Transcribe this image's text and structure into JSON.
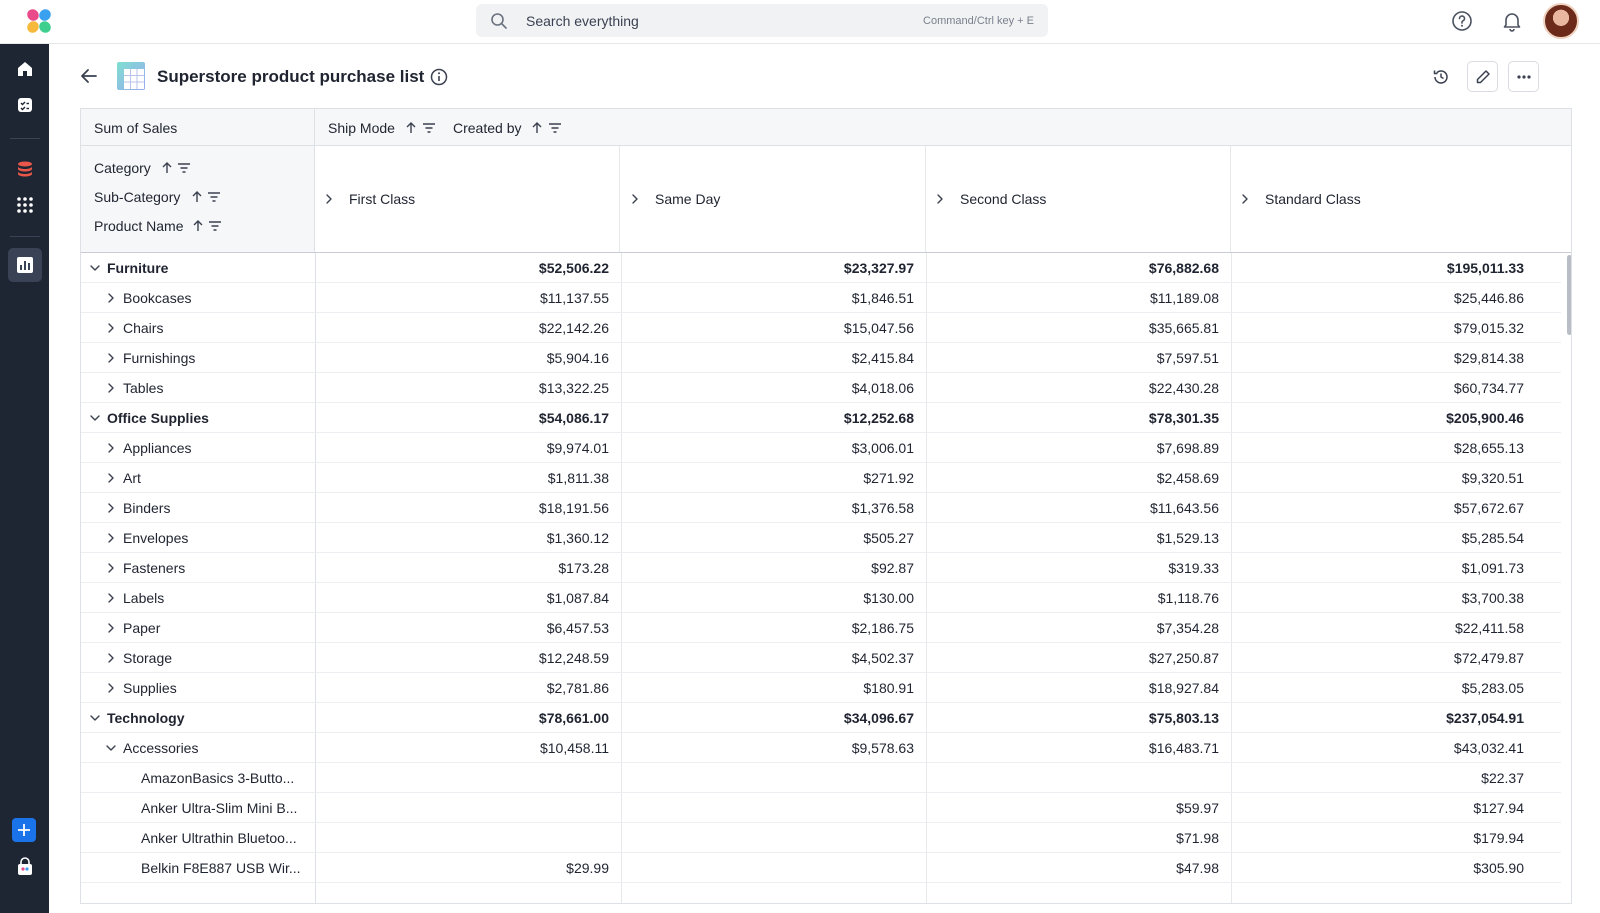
{
  "topbar": {
    "search_placeholder": "Search everything",
    "search_hint": "Command/Ctrl key + E"
  },
  "page": {
    "title": "Superstore product purchase list"
  },
  "pivot": {
    "value_label": "Sum of Sales",
    "column_fields": [
      "Ship Mode",
      "Created by"
    ],
    "row_fields": [
      "Category",
      "Sub-Category",
      "Product Name"
    ],
    "columns": [
      "First Class",
      "Same Day",
      "Second Class",
      "Standard Class"
    ],
    "rows": [
      {
        "level": 0,
        "expanded": true,
        "label": "Furniture",
        "values": [
          "$52,506.22",
          "$23,327.97",
          "$76,882.68",
          "$195,011.33"
        ]
      },
      {
        "level": 1,
        "expanded": false,
        "label": "Bookcases",
        "values": [
          "$11,137.55",
          "$1,846.51",
          "$11,189.08",
          "$25,446.86"
        ]
      },
      {
        "level": 1,
        "expanded": false,
        "label": "Chairs",
        "values": [
          "$22,142.26",
          "$15,047.56",
          "$35,665.81",
          "$79,015.32"
        ]
      },
      {
        "level": 1,
        "expanded": false,
        "label": "Furnishings",
        "values": [
          "$5,904.16",
          "$2,415.84",
          "$7,597.51",
          "$29,814.38"
        ]
      },
      {
        "level": 1,
        "expanded": false,
        "label": "Tables",
        "values": [
          "$13,322.25",
          "$4,018.06",
          "$22,430.28",
          "$60,734.77"
        ]
      },
      {
        "level": 0,
        "expanded": true,
        "label": "Office Supplies",
        "values": [
          "$54,086.17",
          "$12,252.68",
          "$78,301.35",
          "$205,900.46"
        ]
      },
      {
        "level": 1,
        "expanded": false,
        "label": "Appliances",
        "values": [
          "$9,974.01",
          "$3,006.01",
          "$7,698.89",
          "$28,655.13"
        ]
      },
      {
        "level": 1,
        "expanded": false,
        "label": "Art",
        "values": [
          "$1,811.38",
          "$271.92",
          "$2,458.69",
          "$9,320.51"
        ]
      },
      {
        "level": 1,
        "expanded": false,
        "label": "Binders",
        "values": [
          "$18,191.56",
          "$1,376.58",
          "$11,643.56",
          "$57,672.67"
        ]
      },
      {
        "level": 1,
        "expanded": false,
        "label": "Envelopes",
        "values": [
          "$1,360.12",
          "$505.27",
          "$1,529.13",
          "$5,285.54"
        ]
      },
      {
        "level": 1,
        "expanded": false,
        "label": "Fasteners",
        "values": [
          "$173.28",
          "$92.87",
          "$319.33",
          "$1,091.73"
        ]
      },
      {
        "level": 1,
        "expanded": false,
        "label": "Labels",
        "values": [
          "$1,087.84",
          "$130.00",
          "$1,118.76",
          "$3,700.38"
        ]
      },
      {
        "level": 1,
        "expanded": false,
        "label": "Paper",
        "values": [
          "$6,457.53",
          "$2,186.75",
          "$7,354.28",
          "$22,411.58"
        ]
      },
      {
        "level": 1,
        "expanded": false,
        "label": "Storage",
        "values": [
          "$12,248.59",
          "$4,502.37",
          "$27,250.87",
          "$72,479.87"
        ]
      },
      {
        "level": 1,
        "expanded": false,
        "label": "Supplies",
        "values": [
          "$2,781.86",
          "$180.91",
          "$18,927.84",
          "$5,283.05"
        ]
      },
      {
        "level": 0,
        "expanded": true,
        "label": "Technology",
        "values": [
          "$78,661.00",
          "$34,096.67",
          "$75,803.13",
          "$237,054.91"
        ]
      },
      {
        "level": 1,
        "expanded": true,
        "label": "Accessories",
        "values": [
          "$10,458.11",
          "$9,578.63",
          "$16,483.71",
          "$43,032.41"
        ]
      },
      {
        "level": 2,
        "label": "AmazonBasics 3-Butto...",
        "values": [
          "",
          "",
          "",
          "$22.37"
        ]
      },
      {
        "level": 2,
        "label": "Anker Ultra-Slim Mini B...",
        "values": [
          "",
          "",
          "$59.97",
          "$127.94"
        ]
      },
      {
        "level": 2,
        "label": "Anker Ultrathin Bluetoo...",
        "values": [
          "",
          "",
          "$71.98",
          "$179.94"
        ]
      },
      {
        "level": 2,
        "label": "Belkin F8E887 USB Wir...",
        "values": [
          "$29.99",
          "",
          "$47.98",
          "$305.90"
        ]
      }
    ]
  },
  "colors": {
    "sidebar_bg": "#1e2533",
    "accent": "#1a73e8"
  }
}
